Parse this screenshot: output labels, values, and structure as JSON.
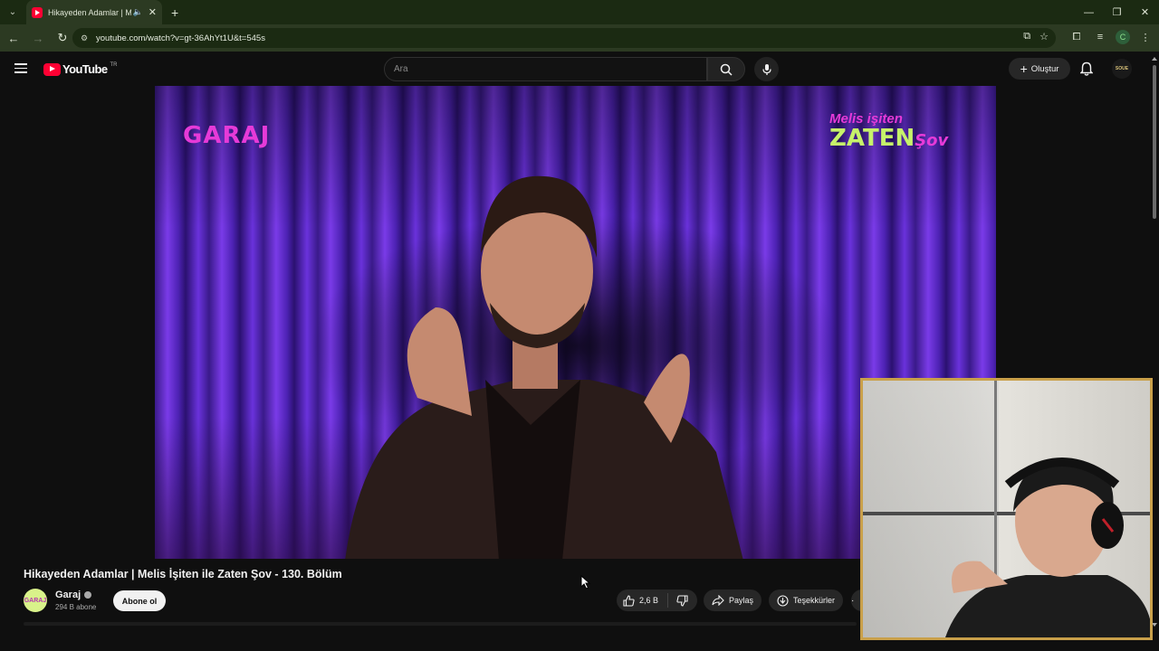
{
  "browser": {
    "tab_title": "Hikayeden Adamlar | Melis İşiten ile Zaten Şov",
    "url": "youtube.com/watch?v=gt-36AhYt1U&t=545s",
    "profile_initial": "C",
    "accent": "#1b2a12"
  },
  "youtube": {
    "logo_text": "YouTube",
    "country_code": "TR",
    "search_placeholder": "Ara",
    "create_label": "Oluştur",
    "avatar_text": "SOUE"
  },
  "video": {
    "overlay_left_logo": "GARAJ",
    "overlay_right_logo_line1": "Melis işiten",
    "overlay_right_logo_line2": "ZATEN",
    "overlay_right_logo_line2_suffix": "Şov",
    "title": "Hikayeden Adamlar | Melis İşiten ile Zaten Şov - 130. Bölüm"
  },
  "channel": {
    "avatar_text": "GARAJ",
    "name": "Garaj",
    "subscribers": "294 B abone",
    "subscribe_label": "Abone ol"
  },
  "actions": {
    "likes": "2,6 B",
    "share_label": "Paylaş",
    "thanks_label": "Teşekkürler"
  },
  "icons": [
    "tab-list-icon",
    "youtube-favicon",
    "audio-icon",
    "close-icon",
    "plus-icon",
    "minimize-icon",
    "restore-icon",
    "close-window-icon",
    "back-icon",
    "forward-icon",
    "reload-icon",
    "site-info-icon",
    "install-icon",
    "star-icon",
    "extensions-icon",
    "media-icon",
    "menu-dots-icon",
    "hamburger-icon",
    "search-icon",
    "mic-icon",
    "bell-icon",
    "verified-icon",
    "like-icon",
    "dislike-icon",
    "share-icon",
    "thanks-icon"
  ]
}
